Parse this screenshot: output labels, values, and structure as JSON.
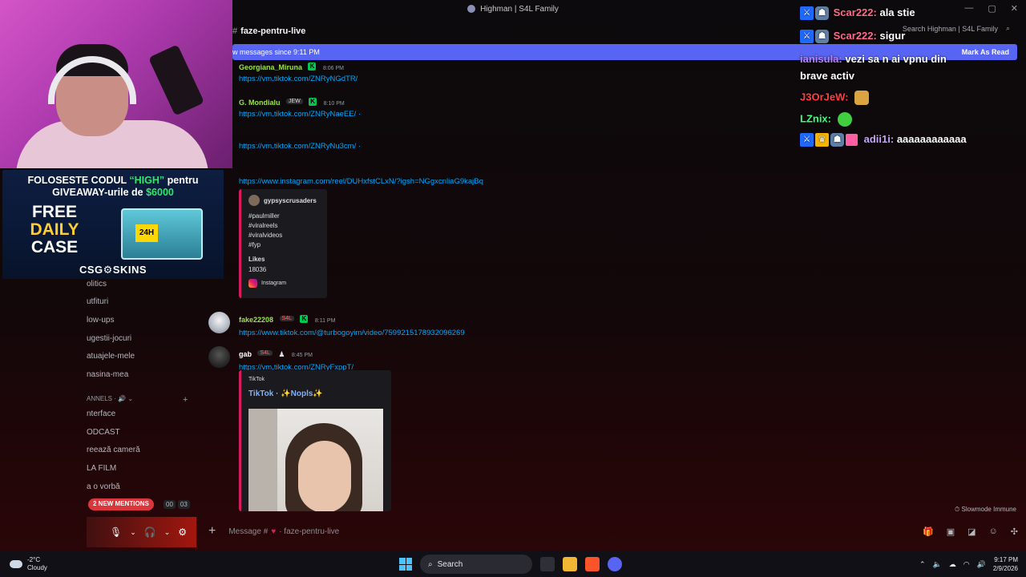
{
  "window": {
    "title": "Highman | S4L Family",
    "controls": [
      "—",
      "▢",
      "✕"
    ]
  },
  "header": {
    "channel": "faze-pentru-live",
    "search_placeholder": "Search Highman | S4L Family"
  },
  "new_messages_bar": {
    "text": "w messages since 9:11 PM",
    "action": "Mark As Read"
  },
  "sidebar": {
    "items": [
      {
        "label": "olitics"
      },
      {
        "label": "utfituri"
      },
      {
        "label": "low-ups"
      },
      {
        "label": "ugestii-jocuri"
      },
      {
        "label": "atuajele-mele"
      },
      {
        "label": "nasina-mea"
      }
    ],
    "voice_header": "ANNELS",
    "voice_items": [
      {
        "label": "nterface"
      },
      {
        "label": "ODCAST"
      },
      {
        "label": "reează cameră"
      },
      {
        "label": "LA FILM"
      },
      {
        "label": "a o vorbă"
      }
    ],
    "mentions": "2 NEW MENTIONS",
    "vc_counts": [
      "00",
      "03"
    ]
  },
  "messages": [
    {
      "author": "Georgiana_Miruna",
      "time": "8:06 PM",
      "lines": [
        "https://vm.tiktok.com/ZNRyNGdTR/"
      ],
      "color": "#9be34a"
    },
    {
      "author": "G. Mondialu",
      "tag": "JEW",
      "time": "8:10 PM",
      "lines": [
        "https://vm.tiktok.com/ZNRyNaeEE/ ·",
        "https://vm.tiktok.com/ZNRyNu3cm/ ·",
        "https://www.instagram.com/reel/DUHxfstCLxN/?igsh=NGgxcnliaG9kajBq"
      ],
      "color": "#9be34a"
    },
    {
      "author": "fake22208",
      "tag": "S4L",
      "time": "8:11 PM",
      "lines": [
        "https://www.tiktok.com/@turbogoyim/video/7599215178932096269"
      ],
      "color": "#9be34a"
    },
    {
      "author": "gab",
      "tag": "S4L",
      "time": "8:45 PM",
      "lines": [
        "https://vm.tiktok.com/ZNRyFxppT/"
      ],
      "color": "#ffffff"
    }
  ],
  "instagram_embed": {
    "user": "gypsyscrusaders",
    "tags": [
      "#paulmiller",
      "#viralreels",
      "#viralvideos",
      "#fyp"
    ],
    "likes_label": "Likes",
    "likes_value": "18036",
    "provider": "Instagram"
  },
  "tiktok_embed": {
    "provider": "TikTok",
    "title": "TikTok · ✨Nopls✨"
  },
  "composer": {
    "placeholder": "Message #",
    "channel": "· faze-pentru-live",
    "slowmode": "Slowmode Immune"
  },
  "ad": {
    "line1_pre": "FOLOSESTE CODUL",
    "line1_code": "“HIGH”",
    "line1_post": "pentru",
    "line2_pre": "GIVEAWAY-urile de",
    "line2_amount": "$6000",
    "free": "FREE",
    "daily": "DAILY",
    "case": "CASE",
    "crate_label": "24H",
    "brand": "CSG⚙SKINS"
  },
  "stream_chat": [
    {
      "user": "Scar222:",
      "text": "ala stie",
      "color": "#ff6b8a"
    },
    {
      "user": "Scar222:",
      "text": "sigur",
      "color": "#ff6b8a"
    },
    {
      "user": "ianisula:",
      "text": "vezi sa n ai vpnu din",
      "text2": "brave activ",
      "color": "#b982ff"
    },
    {
      "user": "J3OrJeW:",
      "text": "",
      "color": "#ff4040"
    },
    {
      "user": "LZnix:",
      "text": "",
      "color": "#3cff7a"
    },
    {
      "user": "adii1i:",
      "text": "aaaaaaaaaaaa",
      "color": "#c8a2ff"
    }
  ],
  "taskbar": {
    "temp": "-2°C",
    "condition": "Cloudy",
    "search": "Search",
    "time": "9:17 PM",
    "date": "2/9/2026"
  }
}
